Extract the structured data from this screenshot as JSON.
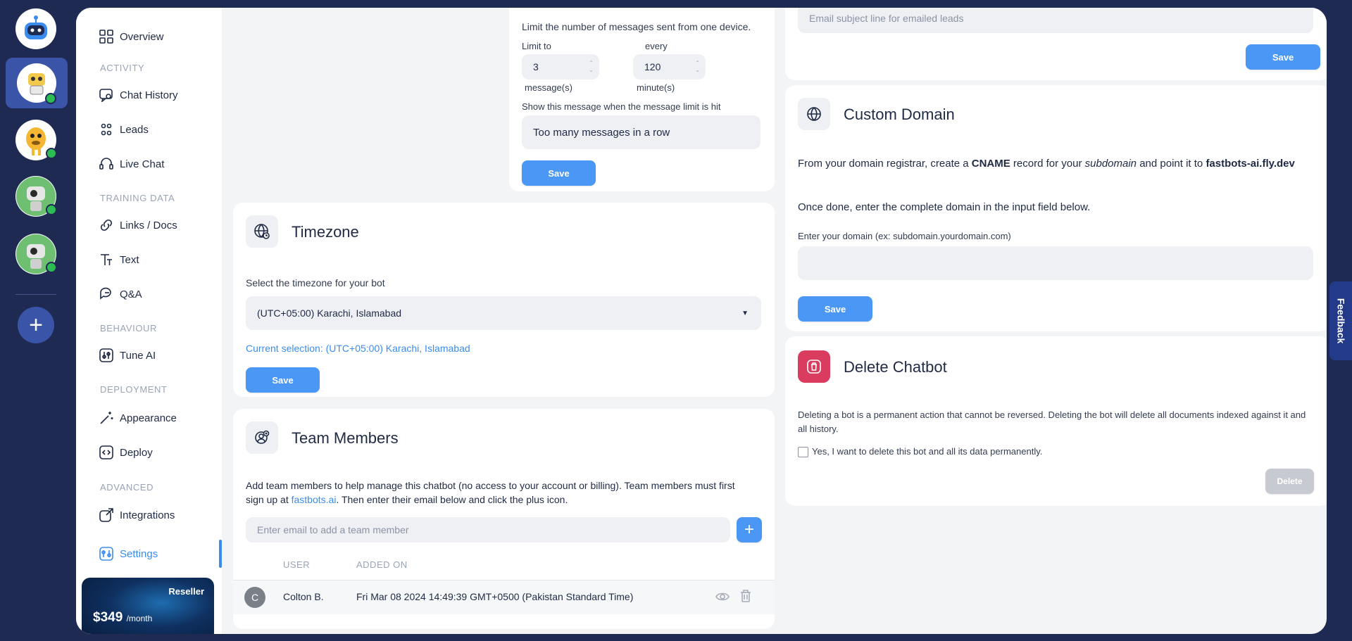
{
  "colors": {
    "accent": "#4a97f6",
    "rail": "#1e2a52",
    "online": "#2dbb54",
    "danger": "#d93c5e"
  },
  "nav": {
    "overview": "Overview",
    "activity_head": "ACTIVITY",
    "chat_history": "Chat History",
    "leads": "Leads",
    "live_chat": "Live Chat",
    "training_head": "TRAINING DATA",
    "links_docs": "Links / Docs",
    "text": "Text",
    "qa": "Q&A",
    "behaviour_head": "BEHAVIOUR",
    "tune_ai": "Tune AI",
    "deployment_head": "DEPLOYMENT",
    "appearance": "Appearance",
    "deploy": "Deploy",
    "advanced_head": "ADVANCED",
    "integrations": "Integrations",
    "settings": "Settings"
  },
  "reseller": {
    "label": "Reseller",
    "price": "$349",
    "period": "/month"
  },
  "rate_limit": {
    "description": "Limit the number of messages sent from one device.",
    "limit_label": "Limit to",
    "limit_value": "3",
    "limit_unit": "message(s)",
    "every_label": "every",
    "every_value": "120",
    "every_unit": "minute(s)",
    "message_label": "Show this message when the message limit is hit",
    "message_value": "Too many messages in a row",
    "save": "Save"
  },
  "timezone": {
    "title": "Timezone",
    "label": "Select the timezone for your bot",
    "selected": "(UTC+05:00) Karachi, Islamabad",
    "current": "Current selection: (UTC+05:00) Karachi, Islamabad",
    "save": "Save"
  },
  "team": {
    "title": "Team Members",
    "desc_part1": "Add team members to help manage this chatbot (no access to your account or billing). Team members must first sign up at ",
    "desc_link": "fastbots.ai",
    "desc_part2": ". Then enter their email below and click the plus icon.",
    "email_placeholder": "Enter email to add a team member",
    "col_user": "USER",
    "col_added": "ADDED ON",
    "members": [
      {
        "initial": "C",
        "name": "Colton B.",
        "added": "Fri Mar 08 2024 14:49:39 GMT+0500 (Pakistan Standard Time)"
      }
    ]
  },
  "email": {
    "subject_placeholder": "Email subject line for emailed leads",
    "save": "Save"
  },
  "custom_domain": {
    "title": "Custom Domain",
    "p1_a": "From your domain registrar, create a ",
    "p1_b": "CNAME",
    "p1_c": " record for your ",
    "p1_d": "subdomain",
    "p1_e": " and point it to ",
    "p1_f": "fastbots-ai.fly.dev",
    "p2": "Once done, enter the complete domain in the input field below.",
    "input_label": "Enter your domain (ex: subdomain.yourdomain.com)",
    "save": "Save"
  },
  "delete_bot": {
    "title": "Delete Chatbot",
    "desc": "Deleting a bot is a permanent action that cannot be reversed. Deleting the bot will delete all documents indexed against it and all history.",
    "confirm": "Yes, I want to delete this bot and all its data permanently.",
    "delete": "Delete"
  },
  "feedback": "Feedback"
}
